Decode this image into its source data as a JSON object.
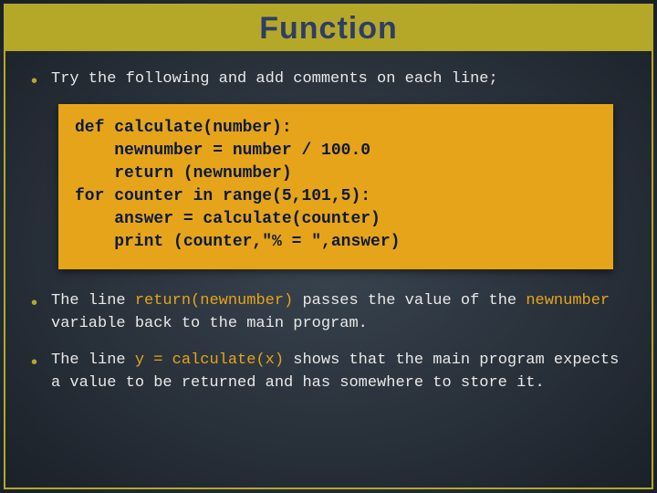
{
  "title": "Function",
  "bullets": {
    "intro": "Try the following and add comments on each line;"
  },
  "code": {
    "lines": [
      "def calculate(number):",
      "    newnumber = number / 100.0",
      "    return (newnumber)",
      "for counter in range(5,101,5):",
      "    answer = calculate(counter)",
      "    print (counter,\"% = \",answer)"
    ]
  },
  "paragraphs": {
    "p1": {
      "pre": "The line ",
      "hl": "return(newnumber)",
      "mid": " passes the value of the ",
      "hl2": "newnumber",
      "post": " variable back to the main program."
    },
    "p2": {
      "pre": "The line ",
      "hl": "y = calculate(x)",
      "post": " shows that the main program expects a value to be returned and has somewhere to store it."
    }
  }
}
